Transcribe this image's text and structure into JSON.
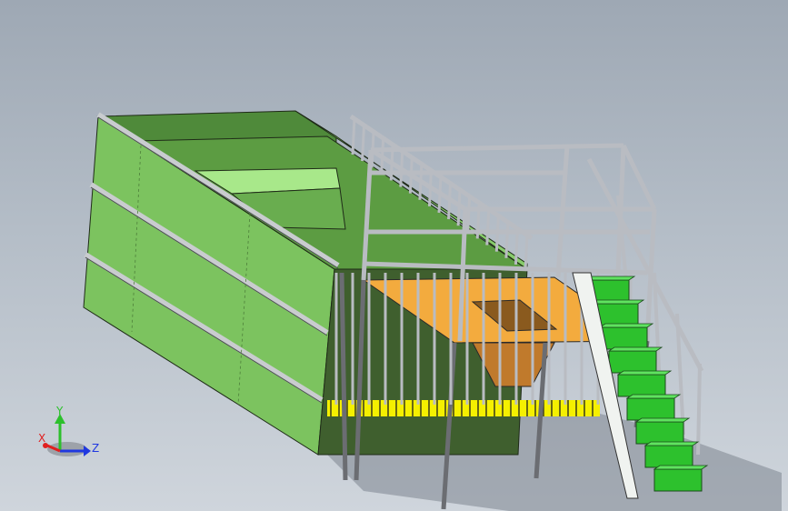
{
  "viewport": {
    "background_top": "#9ea8b4",
    "background_bottom": "#cfd5dc"
  },
  "model": {
    "tank_color": "#79c25f",
    "tank_shadow": "#3f5f2e",
    "platform_color": "#f3ab3e",
    "hopper_color": "#c07a2c",
    "grating_color": "#f5f000",
    "stair_color": "#2dc12d",
    "rail_color": "#b9bcc2",
    "frame_color": "#6b6d72"
  },
  "triad": {
    "x_label": "X",
    "y_label": "Y",
    "z_label": "Z",
    "x_color": "#e02020",
    "y_color": "#2cc02c",
    "z_color": "#2038e0",
    "icon": "coordinate-triad-icon"
  }
}
